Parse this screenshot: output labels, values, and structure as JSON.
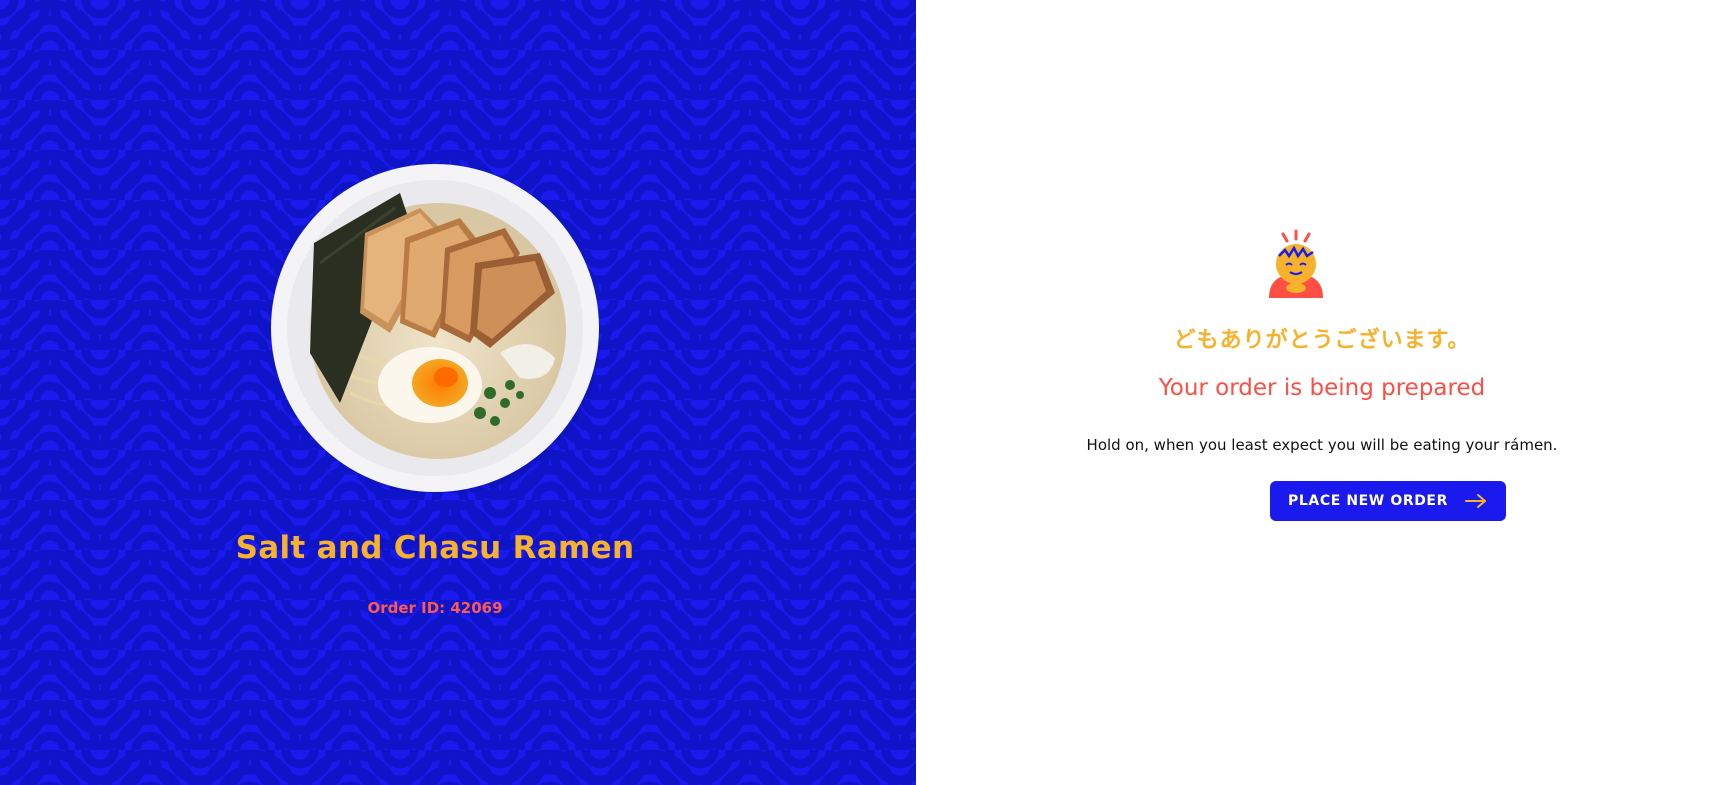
{
  "order": {
    "dish_name": "Salt and Chasu Ramen",
    "order_id_label": "Order ID: 42069"
  },
  "confirmation": {
    "thanks_jp": "どもありがとうございます。",
    "status_title": "Your order is being prepared",
    "hint": "Hold on, when you least expect you will be eating your rámen.",
    "new_order_label": "PLACE NEW ORDER"
  },
  "icons": {
    "arrow": "arrow-right-icon",
    "mascot": "mascot-icon",
    "bowl": "ramen-bowl-image"
  },
  "colors": {
    "brand_blue": "#1a1aef",
    "accent_yellow": "#f7b22c",
    "accent_red": "#ff4f45"
  }
}
